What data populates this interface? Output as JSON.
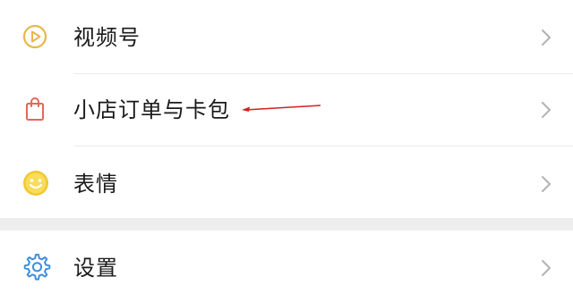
{
  "menu": {
    "items": [
      {
        "label": "视频号",
        "icon": "channels-play-icon"
      },
      {
        "label": "小店订单与卡包",
        "icon": "shopping-bag-icon"
      },
      {
        "label": "表情",
        "icon": "smiley-face-icon"
      },
      {
        "label": "设置",
        "icon": "gear-icon"
      }
    ]
  },
  "colors": {
    "channels_icon": "#e5b84a",
    "bag_icon": "#e06a5a",
    "smiley_icon": "#f2c832",
    "gear_icon": "#3e8fd9",
    "chevron": "#b3b3b3",
    "annotation_arrow": "#d42020"
  }
}
